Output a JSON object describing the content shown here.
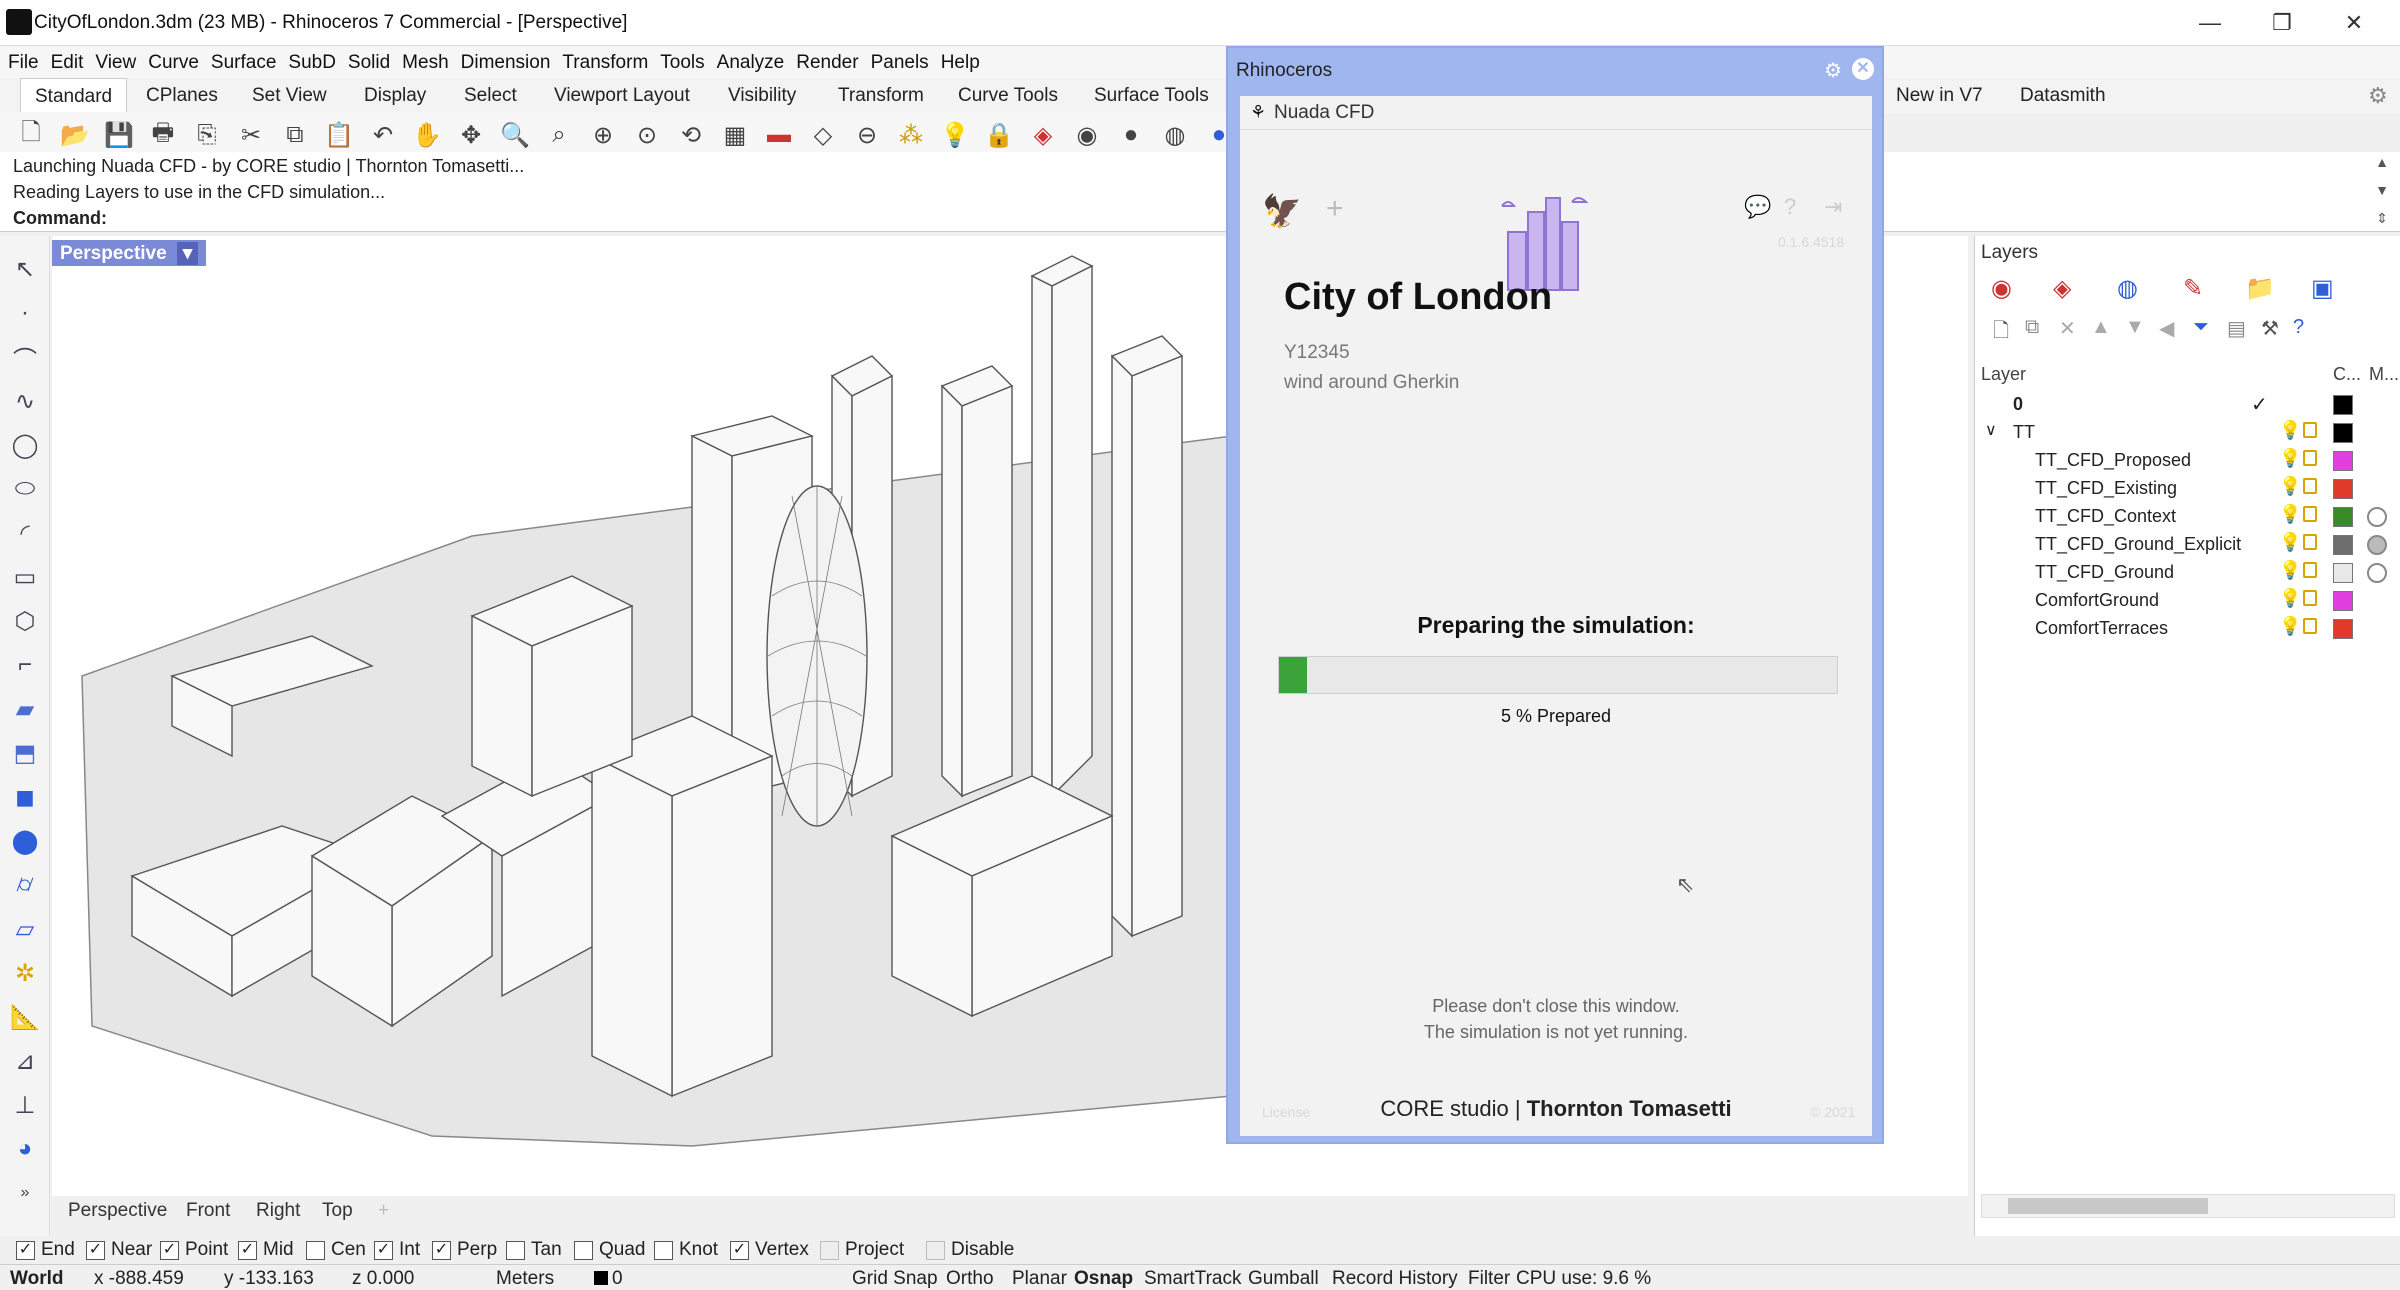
{
  "window": {
    "title": "CityOfLondon.3dm (23 MB) - Rhinoceros 7 Commercial - [Perspective]",
    "controls": {
      "minimize": "—",
      "restore": "❐",
      "close": "✕"
    }
  },
  "menu": [
    "File",
    "Edit",
    "View",
    "Curve",
    "Surface",
    "SubD",
    "Solid",
    "Mesh",
    "Dimension",
    "Transform",
    "Tools",
    "Analyze",
    "Render",
    "Panels",
    "Help"
  ],
  "toolbar_tabs": [
    "Standard",
    "CPlanes",
    "Set View",
    "Display",
    "Select",
    "Viewport Layout",
    "Visibility",
    "Transform",
    "Curve Tools",
    "Surface Tools",
    "New in V7",
    "Datasmith"
  ],
  "command": {
    "lines": [
      "Launching Nuada CFD - by CORE studio | Thornton Tomasetti...",
      "Reading Layers to use in the CFD simulation..."
    ],
    "prompt": "Command:"
  },
  "viewport": {
    "label": "Perspective",
    "tabs": [
      "Perspective",
      "Front",
      "Right",
      "Top"
    ]
  },
  "osnap": [
    {
      "label": "End",
      "checked": true
    },
    {
      "label": "Near",
      "checked": true
    },
    {
      "label": "Point",
      "checked": true
    },
    {
      "label": "Mid",
      "checked": true
    },
    {
      "label": "Cen",
      "checked": false
    },
    {
      "label": "Int",
      "checked": true
    },
    {
      "label": "Perp",
      "checked": true
    },
    {
      "label": "Tan",
      "checked": false
    },
    {
      "label": "Quad",
      "checked": false
    },
    {
      "label": "Knot",
      "checked": false
    },
    {
      "label": "Vertex",
      "checked": true
    },
    {
      "label": "Project",
      "checked": false
    },
    {
      "label": "Disable",
      "checked": false
    }
  ],
  "status": {
    "cplane": "World",
    "x": "x -888.459",
    "y": "y -133.163",
    "z": "z 0.000",
    "units": "Meters",
    "layer": "0",
    "items": [
      "Grid Snap",
      "Ortho",
      "Planar",
      "Osnap",
      "SmartTrack",
      "Gumball",
      "Record History",
      "Filter",
      "CPU use: 9.6 %"
    ]
  },
  "layers": {
    "title": "Layers",
    "col_layer": "Layer",
    "col_color": "C...",
    "col_mat": "M...",
    "rows": [
      {
        "name": "0",
        "color": "#000000",
        "current": true
      },
      {
        "name": "TT",
        "color": "#000000",
        "expanded": true
      },
      {
        "name": "TT_CFD_Proposed",
        "color": "#e040e0",
        "bulb": "yellow"
      },
      {
        "name": "TT_CFD_Existing",
        "color": "#e03a2a",
        "bulb": "blue"
      },
      {
        "name": "TT_CFD_Context",
        "color": "#3a8a2a",
        "bulb": "yellow"
      },
      {
        "name": "TT_CFD_Ground_Explicit",
        "color": "#6e6e6e",
        "bulb": "yellow"
      },
      {
        "name": "TT_CFD_Ground",
        "color": "#e8e8e8",
        "bulb": "yellow"
      },
      {
        "name": "ComfortGround",
        "color": "#e040e0",
        "bulb": "blue"
      },
      {
        "name": "ComfortTerraces",
        "color": "#e03a2a",
        "bulb": "blue"
      }
    ]
  },
  "dialog": {
    "window_title": "Rhinoceros",
    "tab_label": "Nuada CFD",
    "version": "0.1.6.4518",
    "project_name": "City of London",
    "project_code": "Y12345",
    "project_desc": "wind around Gherkin",
    "status_title": "Preparing the simulation:",
    "progress_percent": 5,
    "progress_text": "5 % Prepared",
    "note_line1": "Please don't close this window.",
    "note_line2": "The simulation is not yet running.",
    "footer_left": "CORE studio",
    "footer_sep": "|",
    "footer_right": "Thornton Tomasetti",
    "license": "License",
    "year": "© 2021"
  },
  "colors": {
    "dialog_frame": "#9fb6ef",
    "progress": "#3aa33a",
    "viewport_label": "#7b8ad6"
  }
}
